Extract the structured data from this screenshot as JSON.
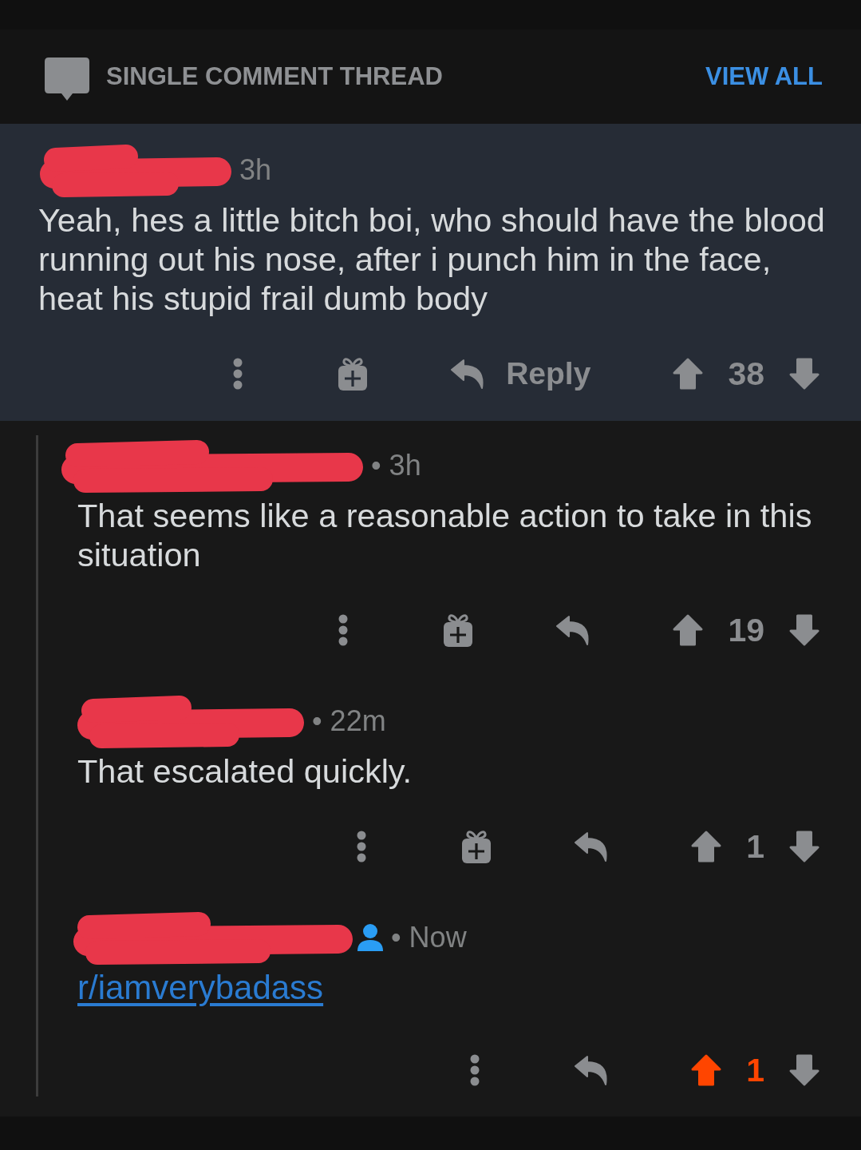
{
  "header": {
    "title": "SINGLE COMMENT THREAD",
    "view_all": "VIEW ALL"
  },
  "comment": {
    "highlighted": true,
    "author_redacted": true,
    "user_icon": false,
    "time": "3h",
    "body": "Yeah, hes a little bitch boi, who should have the blood running out his nose, after i punch him in the face, heat his stupid frail dumb body",
    "award_button": true,
    "reply_label": "Reply",
    "score": "38",
    "upvoted": false,
    "replies": [
      {
        "author_redacted": true,
        "user_icon": false,
        "time": "• 3h",
        "body": "That seems like a reasonable action to take in this situation",
        "award_button": true,
        "score": "19",
        "upvoted": false
      },
      {
        "author_redacted": true,
        "user_icon": false,
        "time": "• 22m",
        "body": "That escalated quickly.",
        "award_button": true,
        "score": "1",
        "upvoted": false
      },
      {
        "author_redacted": true,
        "user_icon": true,
        "time": "• Now",
        "link": "r/iamverybadass",
        "award_button": false,
        "score": "1",
        "upvoted": true
      }
    ]
  }
}
